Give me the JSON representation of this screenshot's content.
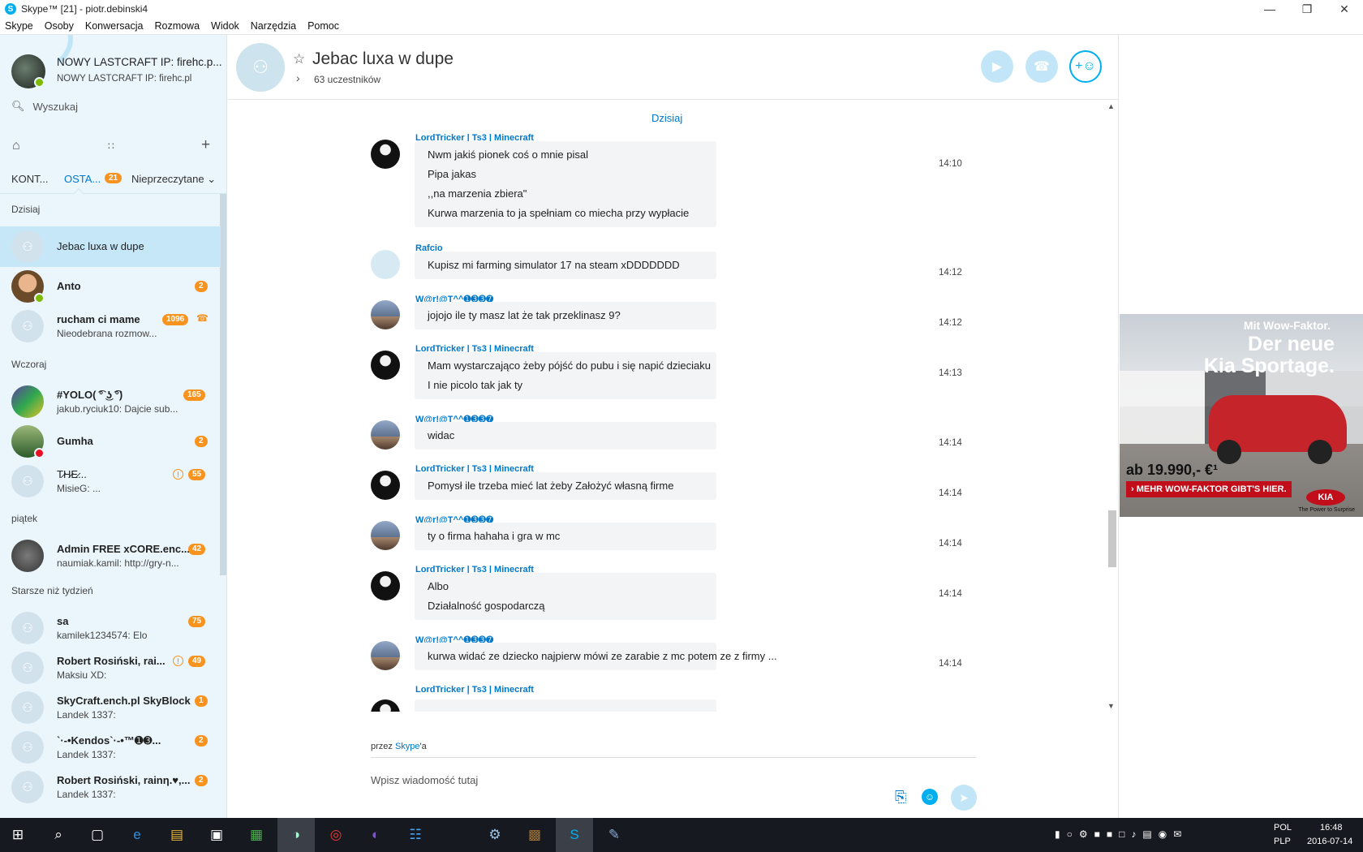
{
  "window": {
    "title": "Skype™ [21] - piotr.debinski4",
    "app_icon": "S",
    "minimize": "—",
    "maximize": "❐",
    "close": "✕"
  },
  "menu": [
    "Skype",
    "Osoby",
    "Konwersacja",
    "Rozmowa",
    "Widok",
    "Narzędzia",
    "Pomoc"
  ],
  "profile": {
    "name": "NOWY LASTCRAFT IP: firehc.p...",
    "mood": "NOWY LASTCRAFT IP: firehc.pl"
  },
  "search": {
    "placeholder": "Wyszukaj"
  },
  "tabs": {
    "contacts": "KONT...",
    "recent": "OSTA...",
    "recent_badge": "21",
    "filter": "Nieprzeczytane"
  },
  "sections": {
    "today": "Dzisiaj",
    "yesterday": "Wczoraj",
    "friday": "piątek",
    "older": "Starsze niż tydzień"
  },
  "contacts": [
    {
      "name": "Jebac luxa w dupe",
      "sub": "",
      "badge": ""
    },
    {
      "name": "Anto",
      "sub": "",
      "badge": "2"
    },
    {
      "name": "rucham ci mame",
      "sub": "Nieodebrana rozmow...",
      "badge": "1096"
    },
    {
      "name": "#YOLO( ͡° ͜ʖ ͡°)",
      "sub": "jakub.ryciuk10: Dajcie sub...",
      "badge": "165"
    },
    {
      "name": "Gumha",
      "sub": "",
      "badge": "2"
    },
    {
      "name": "T̷H̷E̷...",
      "sub": "MisieG: ...",
      "badge": "55"
    },
    {
      "name": "Admin FREE xCORE.enc...",
      "sub": "naumiak.kamil: http://gry-n...",
      "badge": "42"
    },
    {
      "name": "sa",
      "sub": "kamilek1234574: Elo",
      "badge": "75"
    },
    {
      "name": "Robert Rosiński, rai...",
      "sub": "Maksiu XD:",
      "badge": "49"
    },
    {
      "name": "SkyCraft.ench.pl SkyBlock",
      "sub": "Landek 1337:",
      "badge": "1"
    },
    {
      "name": "`·-•Kendos`·-•™➊➌...",
      "sub": "Landek 1337:",
      "badge": "2"
    },
    {
      "name": "Robert Rosiński, rainη.♥,...",
      "sub": "Landek 1337:",
      "badge": "2"
    }
  ],
  "header": {
    "title": "Jebac luxa w dupe",
    "participants": "63 uczestników"
  },
  "chat": {
    "today_label": "Dzisiaj",
    "messages": [
      {
        "sender": "LordTricker | Ts3 | Minecraft",
        "avatar": "lord",
        "time": "14:10",
        "lines": [
          "Nwm jakiś pionek coś o mnie pisal",
          "Pipa jakas",
          ",,na marzenia zbiera\"",
          "Kurwa marzenia to ja spełniam co miecha przy wypłacie"
        ]
      },
      {
        "sender": "Rafcio",
        "avatar": "raf",
        "time": "14:12",
        "lines": [
          "Kupisz mi farming simulator 17 na steam xDDDDDDD"
        ]
      },
      {
        "sender": "W@r!@T^^➊➌➌➐",
        "avatar": "wer",
        "time": "14:12",
        "lines": [
          "jojojo ile ty masz lat że tak przeklinasz 9?"
        ]
      },
      {
        "sender": "LordTricker | Ts3 | Minecraft",
        "avatar": "lord",
        "time": "14:13",
        "lines": [
          "Mam wystarczająco żeby pójść do pubu i się napić dzieciaku",
          "I nie picolo tak jak ty"
        ]
      },
      {
        "sender": "W@r!@T^^➊➌➌➐",
        "avatar": "wer",
        "time": "14:14",
        "lines": [
          "widac"
        ]
      },
      {
        "sender": "LordTricker | Ts3 | Minecraft",
        "avatar": "lord",
        "time": "14:14",
        "lines": [
          "Pomysł ile trzeba mieć lat żeby Założyć własną firme"
        ]
      },
      {
        "sender": "W@r!@T^^➊➌➌➐",
        "avatar": "wer",
        "time": "14:14",
        "lines": [
          "ty o firma hahaha i gra w mc"
        ]
      },
      {
        "sender": "LordTricker | Ts3 | Minecraft",
        "avatar": "lord",
        "time": "14:14",
        "lines": [
          "Albo",
          "Działalność gospodarczą"
        ]
      },
      {
        "sender": "W@r!@T^^➊➌➌➐",
        "avatar": "wer",
        "time": "14:14",
        "lines": [
          "kurwa widać ze dziecko najpierw mówi ze zarabie z mc potem ze z  firmy ..."
        ]
      },
      {
        "sender": "LordTricker | Ts3 | Minecraft",
        "avatar": "lord",
        "time": "",
        "lines": [
          ""
        ]
      }
    ]
  },
  "composer": {
    "via_prefix": "przez ",
    "via_link": "Skype",
    "via_suffix": "'a",
    "placeholder": "Wpisz wiadomość tutaj"
  },
  "ad": {
    "headline_small": "Mit Wow-Faktor.",
    "headline_1": "Der neue",
    "headline_2": "Kia Sportage.",
    "price": "ab 19.990,- €¹",
    "cta": "› MEHR WOW-FAKTOR GIBT'S HIER.",
    "brand": "KIA",
    "slogan": "The Power to Surprise"
  },
  "taskbar": {
    "lang_1": "POL",
    "lang_2": "PLP",
    "time": "16:48",
    "date": "2016-07-14"
  },
  "colors": {
    "skype_blue": "#00aff0",
    "link_blue": "#0078ca",
    "badge_orange": "#f8931f",
    "sidebar_bg": "#eaf6fc",
    "selected_bg": "#c5e7f8"
  }
}
